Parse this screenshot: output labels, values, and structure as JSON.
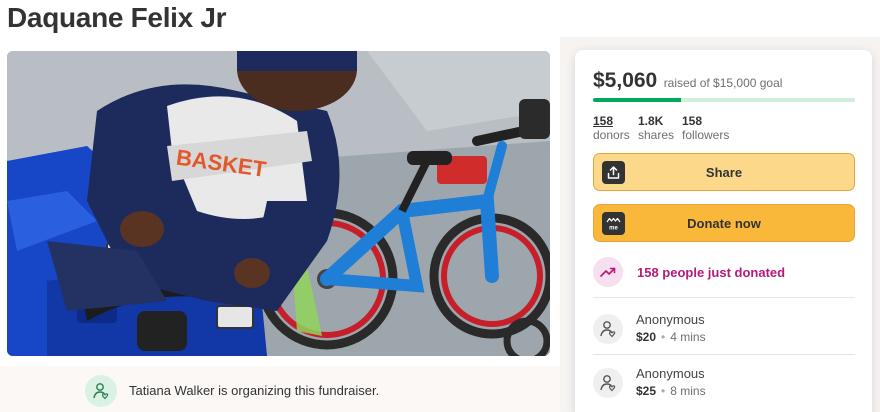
{
  "campaign": {
    "title": "Daquane Felix Jr",
    "organizer_text": "Tatiana Walker is organizing this fundraiser."
  },
  "photo": {
    "shirt_text": "BASKET"
  },
  "donation_box": {
    "raised_amount": "$5,060",
    "goal_text": "raised of $15,000 goal",
    "progress_fraction": 0.3373,
    "stats": [
      {
        "number": "158",
        "label": "donors"
      },
      {
        "number": "1.8K",
        "label": "shares"
      },
      {
        "number": "158",
        "label": "followers"
      }
    ],
    "share_label": "Share",
    "donate_label": "Donate now",
    "recent_activity": "158 people just donated",
    "donations": [
      {
        "name": "Anonymous",
        "amount": "$20",
        "time": "4 mins"
      },
      {
        "name": "Anonymous",
        "amount": "$25",
        "time": "8 mins"
      }
    ]
  },
  "colors": {
    "progress": "#02a95c",
    "share_button": "#fcd98a",
    "donate_button": "#f9b83a",
    "activity_text": "#b5197a"
  },
  "icons": {
    "organizer": "person-heart-icon",
    "share": "share-upload-icon",
    "donate": "gofundme-logo-icon",
    "recent": "trending-up-icon",
    "donor": "person-heart-icon"
  }
}
